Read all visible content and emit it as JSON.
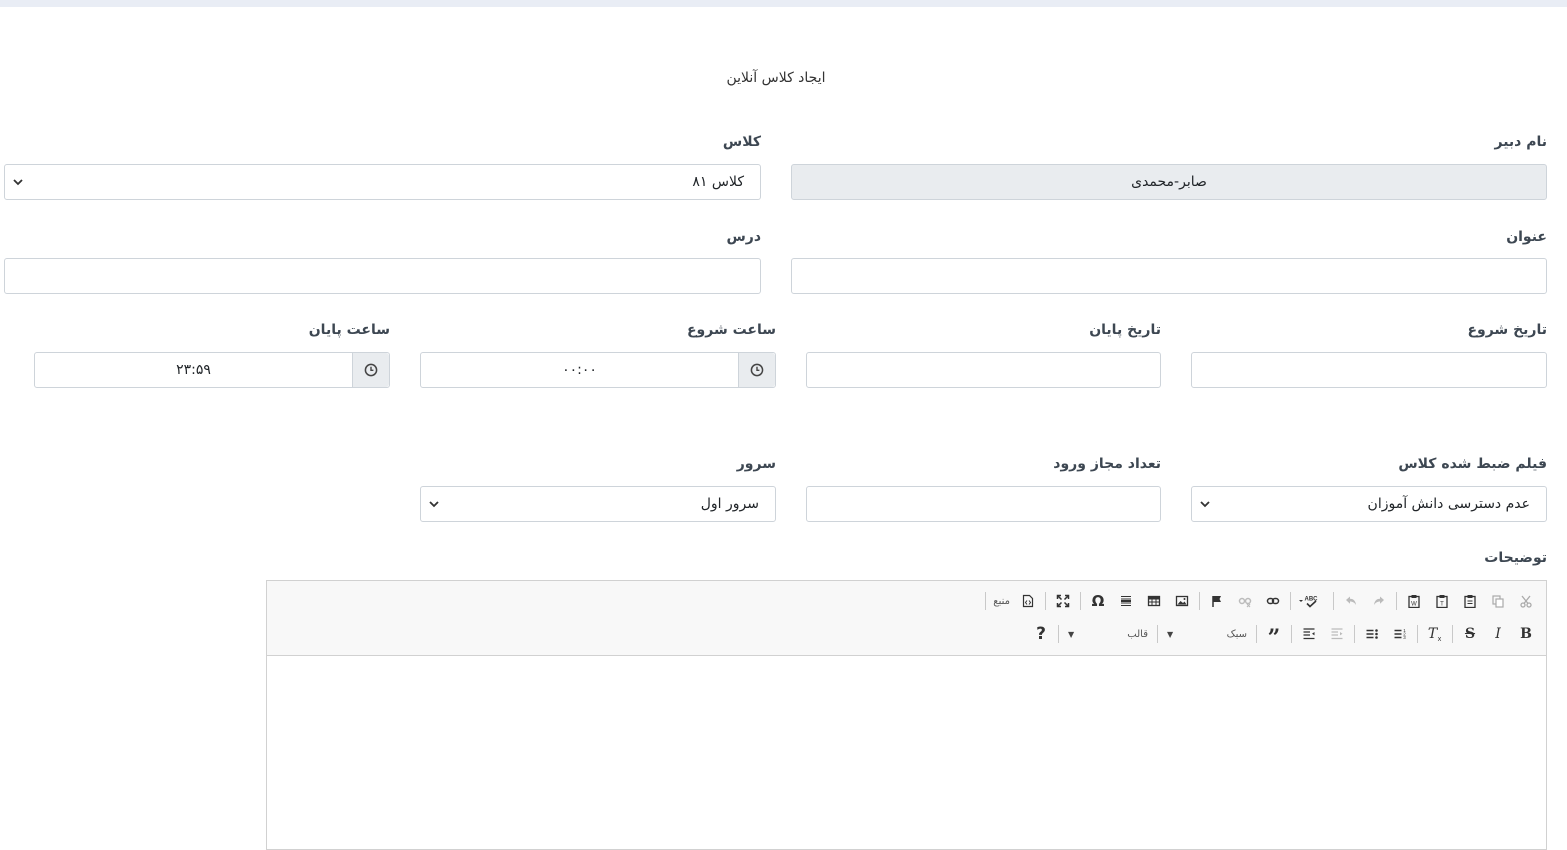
{
  "page": {
    "title": "ایجاد کلاس آنلاین"
  },
  "form": {
    "teacher_name": {
      "label": "نام دبیر",
      "value": "صابر-محمدی"
    },
    "class": {
      "label": "کلاس",
      "value": "کلاس ۸۱"
    },
    "subject_title": {
      "label": "عنوان",
      "value": ""
    },
    "lesson": {
      "label": "درس",
      "value": ""
    },
    "start_date": {
      "label": "تاریخ شروع",
      "value": ""
    },
    "end_date": {
      "label": "تاریخ پایان",
      "value": ""
    },
    "start_time": {
      "label": "ساعت شروع",
      "value": "۰۰:۰۰"
    },
    "end_time": {
      "label": "ساعت پایان",
      "value": "۲۳:۵۹"
    },
    "recorded_video": {
      "label": "فیلم ضبط شده کلاس",
      "value": "عدم دسترسی دانش آموزان"
    },
    "allowed_logins": {
      "label": "تعداد مجاز ورود",
      "value": ""
    },
    "server": {
      "label": "سرور",
      "value": "سرور اول"
    },
    "description": {
      "label": "توضیحات"
    }
  },
  "editor": {
    "source_label": "منبع",
    "style_label": "سبک",
    "format_label": "قالب",
    "toolbar_row1": [
      "cut-icon",
      "copy-icon",
      "paste-icon",
      "paste-text-icon",
      "paste-word-icon",
      "undo-icon",
      "redo-icon",
      "spellcheck-icon",
      "link-icon",
      "unlink-icon",
      "anchor-icon",
      "image-icon",
      "table-icon",
      "horizontal-line-icon",
      "special-char-icon",
      "maximize-icon",
      "source-icon"
    ],
    "toolbar_row2": [
      "bold-icon",
      "italic-icon",
      "strike-icon",
      "remove-format-icon",
      "numbered-list-icon",
      "bulleted-list-icon",
      "outdent-icon",
      "indent-icon",
      "blockquote-icon",
      "help-icon"
    ]
  }
}
